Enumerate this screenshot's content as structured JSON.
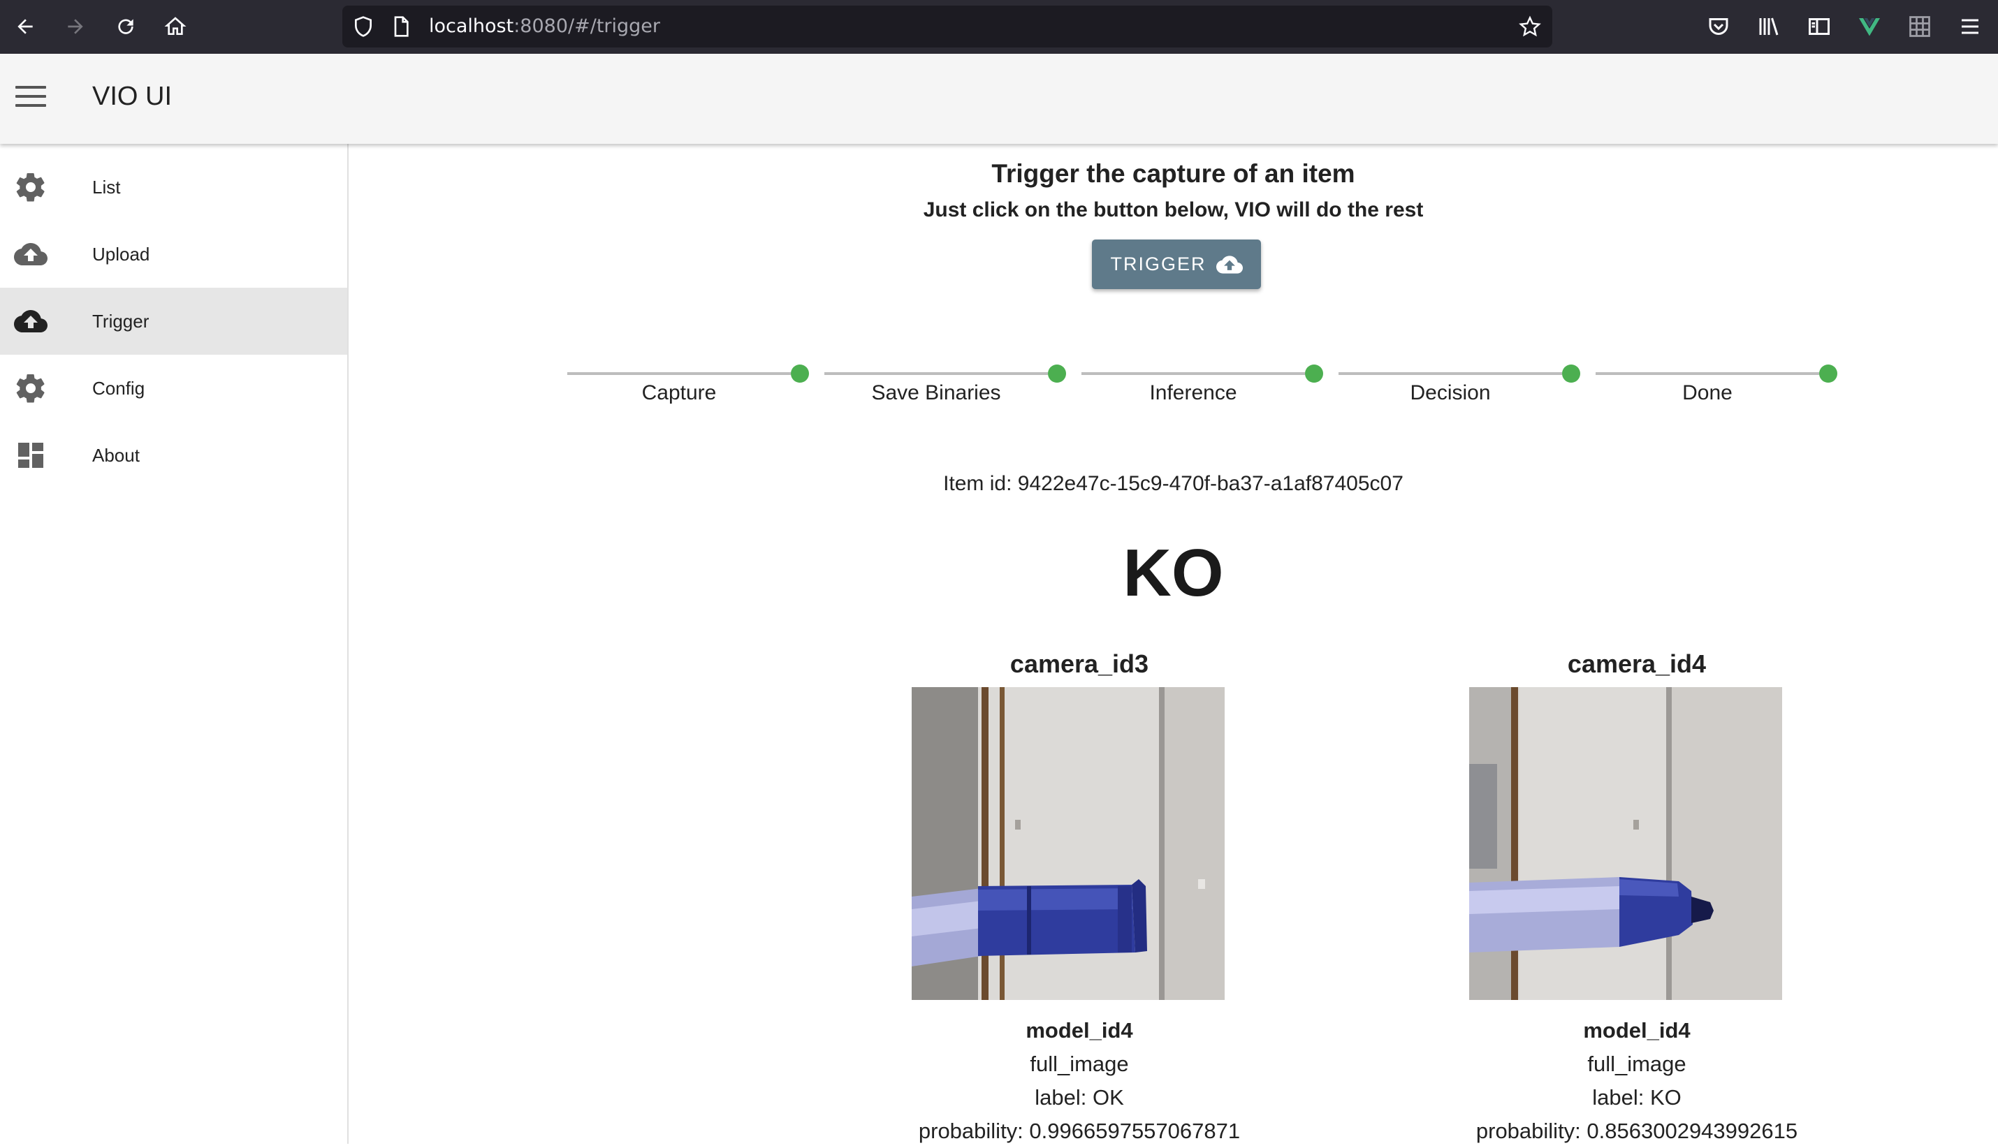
{
  "browser": {
    "url_host": "localhost",
    "url_rest": ":8080/#/trigger"
  },
  "header": {
    "title": "VIO UI"
  },
  "sidebar": {
    "items": [
      {
        "label": "List",
        "icon": "gear-icon"
      },
      {
        "label": "Upload",
        "icon": "cloud-upload-icon"
      },
      {
        "label": "Trigger",
        "icon": "cloud-upload-icon",
        "active": true
      },
      {
        "label": "Config",
        "icon": "gear-icon"
      },
      {
        "label": "About",
        "icon": "dashboard-icon"
      }
    ]
  },
  "main": {
    "title": "Trigger the capture of an item",
    "subtitle": "Just click on the button below, VIO will do the rest",
    "trigger_label": "TRIGGER",
    "steps": [
      {
        "label": "Capture",
        "status": "complete"
      },
      {
        "label": "Save Binaries",
        "status": "complete"
      },
      {
        "label": "Inference",
        "status": "complete"
      },
      {
        "label": "Decision",
        "status": "complete"
      },
      {
        "label": "Done",
        "status": "complete"
      }
    ],
    "item_id": "Item id: 9422e47c-15c9-470f-ba37-a1af87405c07",
    "verdict": "KO",
    "cameras": [
      {
        "name": "camera_id3",
        "model": "model_id4",
        "image_type": "full_image",
        "label": "label: OK",
        "probability": "probability: 0.9966597557067871"
      },
      {
        "name": "camera_id4",
        "model": "model_id4",
        "image_type": "full_image",
        "label": "label: KO",
        "probability": "probability: 0.8563002943992615"
      }
    ]
  },
  "colors": {
    "step_complete": "#4caf50",
    "trigger_button": "#5f7a8a",
    "browser_chrome": "#2b2a33"
  }
}
